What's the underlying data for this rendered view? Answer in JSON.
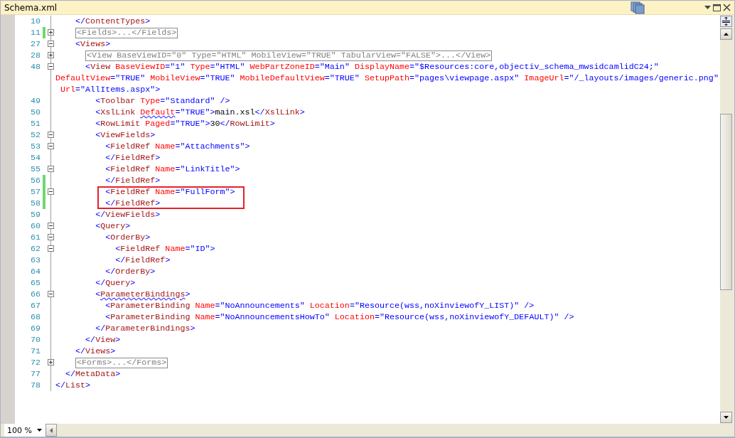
{
  "document_tab": {
    "title": "Schema.xml"
  },
  "lines": [
    {
      "children": [
        {
          "children": [
            {
              "number": "10",
              "foldable": false,
              "changed": false,
              "highlighted": false,
              "parts": [
                {
                  "text": "</",
                  "kind": "bracket"
                },
                {
                  "text": "ContentTypes",
                  "kind": "element"
                },
                {
                  "text": ">",
                  "kind": "bracket"
                }
              ]
            },
            {
              "number": "11",
              "foldable": true,
              "expanded": false,
              "changed": true,
              "highlighted": false,
              "parts": [
                {
                  "text": "<Fields>...</Fields>",
                  "kind": "collapsed"
                }
              ]
            },
            {
              "number": "27",
              "foldable": true,
              "expanded": true,
              "changed": false,
              "highlighted": false,
              "parts": [
                {
                  "text": "<",
                  "kind": "bracket"
                },
                {
                  "text": "Views",
                  "kind": "element"
                },
                {
                  "text": ">",
                  "kind": "bracket"
                }
              ],
              "children": [
                {
                  "number": "28",
                  "foldable": true,
                  "expanded": false,
                  "changed": false,
                  "highlighted": false,
                  "parts": [
                    {
                      "text": "<View BaseViewID=\"0\" Type=\"HTML\" MobileView=\"TRUE\" TabularView=\"FALSE\">...</View>",
                      "kind": "collapsed"
                    }
                  ]
                },
                {
                  "number": "48",
                  "foldable": true,
                  "expanded": true,
                  "changed": false,
                  "highlighted": false,
                  "parts": [
                    {
                      "text": "<",
                      "kind": "bracket"
                    },
                    {
                      "text": "View",
                      "kind": "element"
                    },
                    {
                      "text": " BaseViewID",
                      "kind": "attribute"
                    },
                    {
                      "text": "=\"1\"",
                      "kind": "value"
                    },
                    {
                      "text": " Type",
                      "kind": "attribute"
                    },
                    {
                      "text": "=\"HTML\"",
                      "kind": "value"
                    },
                    {
                      "text": " WebPartZoneID",
                      "kind": "attribute"
                    },
                    {
                      "text": "=\"Main\"",
                      "kind": "value"
                    },
                    {
                      "text": " DisplayName",
                      "kind": "attribute"
                    },
                    {
                      "text": "=\"$Resources:core,objectiv_schema_mwsidcamlidC24;\"",
                      "kind": "value"
                    }
                  ],
                  "wrapped": [
                    [
                      {
                        "text": "DefaultView",
                        "kind": "attribute"
                      },
                      {
                        "text": "=\"TRUE\"",
                        "kind": "value"
                      },
                      {
                        "text": " MobileView",
                        "kind": "attribute"
                      },
                      {
                        "text": "=\"TRUE\"",
                        "kind": "value"
                      },
                      {
                        "text": " MobileDefaultView",
                        "kind": "attribute"
                      },
                      {
                        "text": "=\"TRUE\"",
                        "kind": "value"
                      },
                      {
                        "text": " SetupPath",
                        "kind": "attribute"
                      },
                      {
                        "text": "=\"pages\\viewpage.aspx\"",
                        "kind": "value"
                      },
                      {
                        "text": " ImageUrl",
                        "kind": "attribute"
                      },
                      {
                        "text": "=\"/_layouts/images/generic.png\"",
                        "kind": "value"
                      }
                    ],
                    [
                      {
                        "text": " Url",
                        "kind": "attribute"
                      },
                      {
                        "text": "=\"AllItems.aspx\"",
                        "kind": "value"
                      },
                      {
                        "text": ">",
                        "kind": "bracket"
                      }
                    ]
                  ],
                  "children": [
                    {
                      "number": "49",
                      "foldable": false,
                      "changed": false,
                      "highlighted": false,
                      "parts": [
                        {
                          "text": "<",
                          "kind": "bracket"
                        },
                        {
                          "text": "Toolbar",
                          "kind": "element"
                        },
                        {
                          "text": " Type",
                          "kind": "attribute"
                        },
                        {
                          "text": "=\"Standard\" />",
                          "kind": "value"
                        }
                      ]
                    },
                    {
                      "number": "50",
                      "foldable": false,
                      "changed": false,
                      "highlighted": false,
                      "parts": [
                        {
                          "text": "<",
                          "kind": "bracket"
                        },
                        {
                          "text": "XslLink ",
                          "kind": "element"
                        },
                        {
                          "text": "Default",
                          "kind": "flaggedattribute"
                        },
                        {
                          "text": "=\"TRUE\">",
                          "kind": "value"
                        },
                        {
                          "text": "main.xsl",
                          "kind": "text"
                        },
                        {
                          "text": "</",
                          "kind": "bracket"
                        },
                        {
                          "text": "XslLink",
                          "kind": "element"
                        },
                        {
                          "text": ">",
                          "kind": "bracket"
                        }
                      ]
                    },
                    {
                      "number": "51",
                      "foldable": false,
                      "changed": false,
                      "highlighted": false,
                      "parts": [
                        {
                          "text": "<",
                          "kind": "bracket"
                        },
                        {
                          "text": "RowLimit",
                          "kind": "element"
                        },
                        {
                          "text": " Paged",
                          "kind": "attribute"
                        },
                        {
                          "text": "=\"TRUE\">",
                          "kind": "value"
                        },
                        {
                          "text": "30",
                          "kind": "text"
                        },
                        {
                          "text": "</",
                          "kind": "bracket"
                        },
                        {
                          "text": "RowLimit",
                          "kind": "element"
                        },
                        {
                          "text": ">",
                          "kind": "bracket"
                        }
                      ]
                    },
                    {
                      "number": "52",
                      "foldable": true,
                      "expanded": true,
                      "changed": false,
                      "highlighted": false,
                      "parts": [
                        {
                          "text": "<",
                          "kind": "bracket"
                        },
                        {
                          "text": "ViewFields",
                          "kind": "element"
                        },
                        {
                          "text": ">",
                          "kind": "bracket"
                        }
                      ],
                      "children": [
                        {
                          "number": "53",
                          "foldable": true,
                          "expanded": true,
                          "changed": false,
                          "highlighted": false,
                          "parts": [
                            {
                              "text": "<",
                              "kind": "bracket"
                            },
                            {
                              "text": "FieldRef",
                              "kind": "element"
                            },
                            {
                              "text": " Name",
                              "kind": "attribute"
                            },
                            {
                              "text": "=\"Attachments\">",
                              "kind": "value"
                            }
                          ]
                        },
                        {
                          "number": "54",
                          "foldable": false,
                          "changed": false,
                          "highlighted": false,
                          "parts": [
                            {
                              "text": "</",
                              "kind": "bracket"
                            },
                            {
                              "text": "FieldRef",
                              "kind": "element"
                            },
                            {
                              "text": ">",
                              "kind": "bracket"
                            }
                          ]
                        },
                        {
                          "number": "55",
                          "foldable": true,
                          "expanded": true,
                          "changed": false,
                          "highlighted": false,
                          "parts": [
                            {
                              "text": "<",
                              "kind": "bracket"
                            },
                            {
                              "text": "FieldRef",
                              "kind": "element"
                            },
                            {
                              "text": " Name",
                              "kind": "attribute"
                            },
                            {
                              "text": "=\"LinkTitle\">",
                              "kind": "value"
                            }
                          ]
                        },
                        {
                          "number": "56",
                          "foldable": false,
                          "changed": true,
                          "highlighted": false,
                          "parts": [
                            {
                              "text": "</",
                              "kind": "bracket"
                            },
                            {
                              "text": "FieldRef",
                              "kind": "element"
                            },
                            {
                              "text": ">",
                              "kind": "bracket"
                            }
                          ]
                        },
                        {
                          "number": "57",
                          "foldable": true,
                          "expanded": true,
                          "changed": true,
                          "highlighted": true,
                          "parts": [
                            {
                              "text": "<",
                              "kind": "bracket"
                            },
                            {
                              "text": "FieldRef",
                              "kind": "element"
                            },
                            {
                              "text": " Name",
                              "kind": "attribute"
                            },
                            {
                              "text": "=\"FullForm\">",
                              "kind": "value"
                            }
                          ]
                        },
                        {
                          "number": "58",
                          "foldable": false,
                          "changed": true,
                          "highlighted": true,
                          "parts": [
                            {
                              "text": "</",
                              "kind": "bracket"
                            },
                            {
                              "text": "FieldRef",
                              "kind": "element"
                            },
                            {
                              "text": ">",
                              "kind": "bracket"
                            }
                          ]
                        }
                      ]
                    },
                    {
                      "number": "59",
                      "foldable": false,
                      "changed": false,
                      "highlighted": false,
                      "parts": [
                        {
                          "text": "</",
                          "kind": "bracket"
                        },
                        {
                          "text": "ViewFields",
                          "kind": "element"
                        },
                        {
                          "text": ">",
                          "kind": "bracket"
                        }
                      ]
                    },
                    {
                      "number": "60",
                      "foldable": true,
                      "expanded": true,
                      "changed": false,
                      "highlighted": false,
                      "parts": [
                        {
                          "text": "<",
                          "kind": "bracket"
                        },
                        {
                          "text": "Query",
                          "kind": "element"
                        },
                        {
                          "text": ">",
                          "kind": "bracket"
                        }
                      ],
                      "children": [
                        {
                          "number": "61",
                          "foldable": true,
                          "expanded": true,
                          "changed": false,
                          "highlighted": false,
                          "parts": [
                            {
                              "text": "<",
                              "kind": "bracket"
                            },
                            {
                              "text": "OrderBy",
                              "kind": "element"
                            },
                            {
                              "text": ">",
                              "kind": "bracket"
                            }
                          ],
                          "children": [
                            {
                              "number": "62",
                              "foldable": true,
                              "expanded": true,
                              "changed": false,
                              "highlighted": false,
                              "parts": [
                                {
                                  "text": "<",
                                  "kind": "bracket"
                                },
                                {
                                  "text": "FieldRef",
                                  "kind": "element"
                                },
                                {
                                  "text": " Name",
                                  "kind": "attribute"
                                },
                                {
                                  "text": "=\"ID\">",
                                  "kind": "value"
                                }
                              ]
                            },
                            {
                              "number": "63",
                              "foldable": false,
                              "changed": false,
                              "highlighted": false,
                              "parts": [
                                {
                                  "text": "</",
                                  "kind": "bracket"
                                },
                                {
                                  "text": "FieldRef",
                                  "kind": "element"
                                },
                                {
                                  "text": ">",
                                  "kind": "bracket"
                                }
                              ]
                            }
                          ]
                        },
                        {
                          "number": "64",
                          "foldable": false,
                          "changed": false,
                          "highlighted": false,
                          "parts": [
                            {
                              "text": "</",
                              "kind": "bracket"
                            },
                            {
                              "text": "OrderBy",
                              "kind": "element"
                            },
                            {
                              "text": ">",
                              "kind": "bracket"
                            }
                          ]
                        }
                      ]
                    },
                    {
                      "number": "65",
                      "foldable": false,
                      "changed": false,
                      "highlighted": false,
                      "parts": [
                        {
                          "text": "</",
                          "kind": "bracket"
                        },
                        {
                          "text": "Query",
                          "kind": "element"
                        },
                        {
                          "text": ">",
                          "kind": "bracket"
                        }
                      ]
                    },
                    {
                      "number": "66",
                      "foldable": true,
                      "expanded": true,
                      "changed": false,
                      "highlighted": false,
                      "parts": [
                        {
                          "text": "<",
                          "kind": "bracket"
                        },
                        {
                          "text": "ParameterBindings",
                          "kind": "flaggedelement"
                        },
                        {
                          "text": ">",
                          "kind": "bracket"
                        }
                      ],
                      "children": [
                        {
                          "number": "67",
                          "foldable": false,
                          "changed": false,
                          "highlighted": false,
                          "parts": [
                            {
                              "text": "<",
                              "kind": "bracket"
                            },
                            {
                              "text": "ParameterBinding",
                              "kind": "element"
                            },
                            {
                              "text": " Name",
                              "kind": "attribute"
                            },
                            {
                              "text": "=\"NoAnnouncements\"",
                              "kind": "value"
                            },
                            {
                              "text": " Location",
                              "kind": "attribute"
                            },
                            {
                              "text": "=\"Resource(wss,noXinviewofY_LIST)\" />",
                              "kind": "value"
                            }
                          ]
                        },
                        {
                          "number": "68",
                          "foldable": false,
                          "changed": false,
                          "highlighted": false,
                          "parts": [
                            {
                              "text": "<",
                              "kind": "bracket"
                            },
                            {
                              "text": "ParameterBinding",
                              "kind": "element"
                            },
                            {
                              "text": " Name",
                              "kind": "attribute"
                            },
                            {
                              "text": "=\"NoAnnouncementsHowTo\"",
                              "kind": "value"
                            },
                            {
                              "text": " Location",
                              "kind": "attribute"
                            },
                            {
                              "text": "=\"Resource(wss,noXinviewofY_DEFAULT)\" />",
                              "kind": "value"
                            }
                          ]
                        }
                      ]
                    },
                    {
                      "number": "69",
                      "foldable": false,
                      "changed": false,
                      "highlighted": false,
                      "parts": [
                        {
                          "text": "</",
                          "kind": "bracket"
                        },
                        {
                          "text": "ParameterBindings",
                          "kind": "element"
                        },
                        {
                          "text": ">",
                          "kind": "bracket"
                        }
                      ]
                    }
                  ]
                },
                {
                  "number": "70",
                  "foldable": false,
                  "changed": false,
                  "highlighted": false,
                  "parts": [
                    {
                      "text": "</",
                      "kind": "bracket"
                    },
                    {
                      "text": "View",
                      "kind": "element"
                    },
                    {
                      "text": ">",
                      "kind": "bracket"
                    }
                  ]
                }
              ]
            },
            {
              "number": "71",
              "foldable": false,
              "changed": false,
              "highlighted": false,
              "parts": [
                {
                  "text": "</",
                  "kind": "bracket"
                },
                {
                  "text": "Views",
                  "kind": "element"
                },
                {
                  "text": ">",
                  "kind": "bracket"
                }
              ]
            },
            {
              "number": "72",
              "foldable": true,
              "expanded": false,
              "changed": false,
              "highlighted": false,
              "parts": [
                {
                  "text": "<Forms>...</Forms>",
                  "kind": "collapsed"
                }
              ]
            }
          ]
        },
        {
          "number": "77",
          "foldable": false,
          "changed": false,
          "highlighted": false,
          "parts": [
            {
              "text": "</",
              "kind": "bracket"
            },
            {
              "text": "MetaData",
              "kind": "element"
            },
            {
              "text": ">",
              "kind": "bracket"
            }
          ]
        }
      ]
    },
    {
      "number": "78",
      "foldable": false,
      "changed": false,
      "highlighted": false,
      "parts": [
        {
          "text": "</",
          "kind": "bracket"
        },
        {
          "text": "List",
          "kind": "element"
        },
        {
          "text": ">",
          "kind": "bracket"
        }
      ]
    }
  ],
  "zoom": {
    "value": "100 %"
  }
}
